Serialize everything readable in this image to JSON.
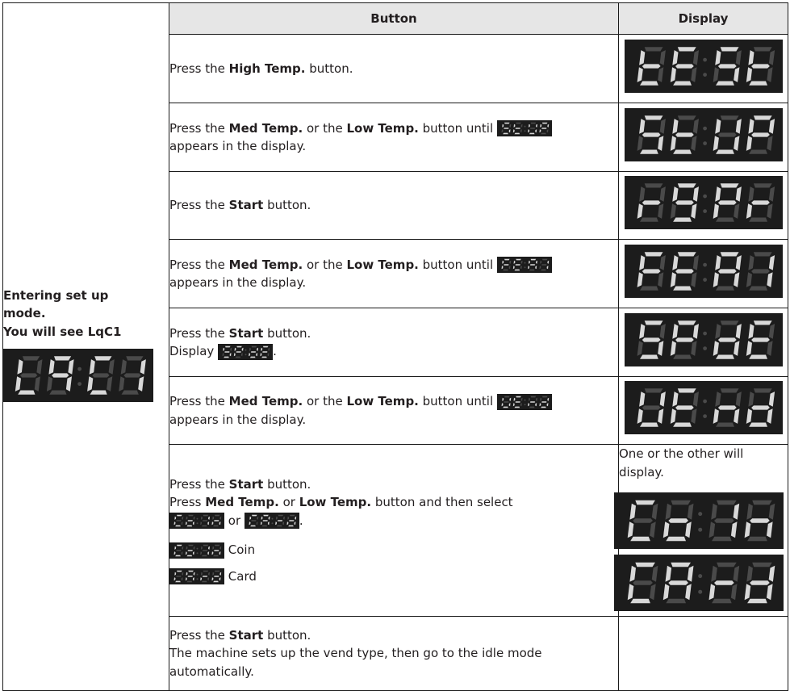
{
  "intro": {
    "title_line1": "Entering set up",
    "title_line2": "mode.",
    "title_line3": "You will see LqC1",
    "display_code": "LqC1"
  },
  "headers": {
    "button": "Button",
    "display": "Display"
  },
  "rows": [
    {
      "pre": "Press the ",
      "bold": "High Temp.",
      "post": " button.",
      "display": "tESt"
    },
    {
      "pre": "Press the ",
      "bold": "Med Temp.",
      "mid": " or the ",
      "bold2": "Low Temp.",
      "post": " button until ",
      "code": "StUP",
      "line2": "appears in the display.",
      "display": "StUP"
    },
    {
      "pre": "Press the ",
      "bold": "Start",
      "post": " button.",
      "display": "r9Pr"
    },
    {
      "pre": "Press the ",
      "bold": "Med Temp.",
      "mid": " or the ",
      "bold2": "Low Temp.",
      "post": " button until ",
      "code": "FEA1",
      "line2": "appears in the display.",
      "display": "FEA1"
    },
    {
      "pre": "Press the ",
      "bold": "Start",
      "post": " button.",
      "line2_pre": "Display ",
      "code": "SPdE",
      "line2_post": ".",
      "display": "SPdE"
    },
    {
      "pre": "Press the ",
      "bold": "Med Temp.",
      "mid": " or the ",
      "bold2": "Low Temp.",
      "post": " button until ",
      "code": "UEnd",
      "line2": "appears in the display.",
      "display": "UEnd"
    },
    {
      "pre": "Press the ",
      "bold": "Start",
      "post": " button.",
      "line2_pre": "Press ",
      "line2_bold": "Med Temp.",
      "line2_mid": " or ",
      "line2_bold2": "Low Temp.",
      "line2_post": " button and then select",
      "code_a": "CoIn",
      "or_text": " or ",
      "code_b": "CArd",
      "period": ".",
      "opt_a_code": "CoIn",
      "opt_a_label": "Coin",
      "opt_b_code": "CArd",
      "opt_b_label": "Card",
      "display_note_1": "One or the other will",
      "display_note_2": "display.",
      "display_a": "CoIn",
      "display_b": "CArd"
    },
    {
      "pre": "Press the ",
      "bold": "Start",
      "post": " button.",
      "line2": "The machine sets up the vend type, then go to the idle mode",
      "line3": "automatically."
    }
  ],
  "colors": {
    "lcd_bg": "#1c1c1c",
    "segment": "#d8d8d8",
    "segment_dim": "#4a4a4a",
    "mini_bg": "#1c1c1c",
    "header_bg": "#e6e6e6"
  }
}
